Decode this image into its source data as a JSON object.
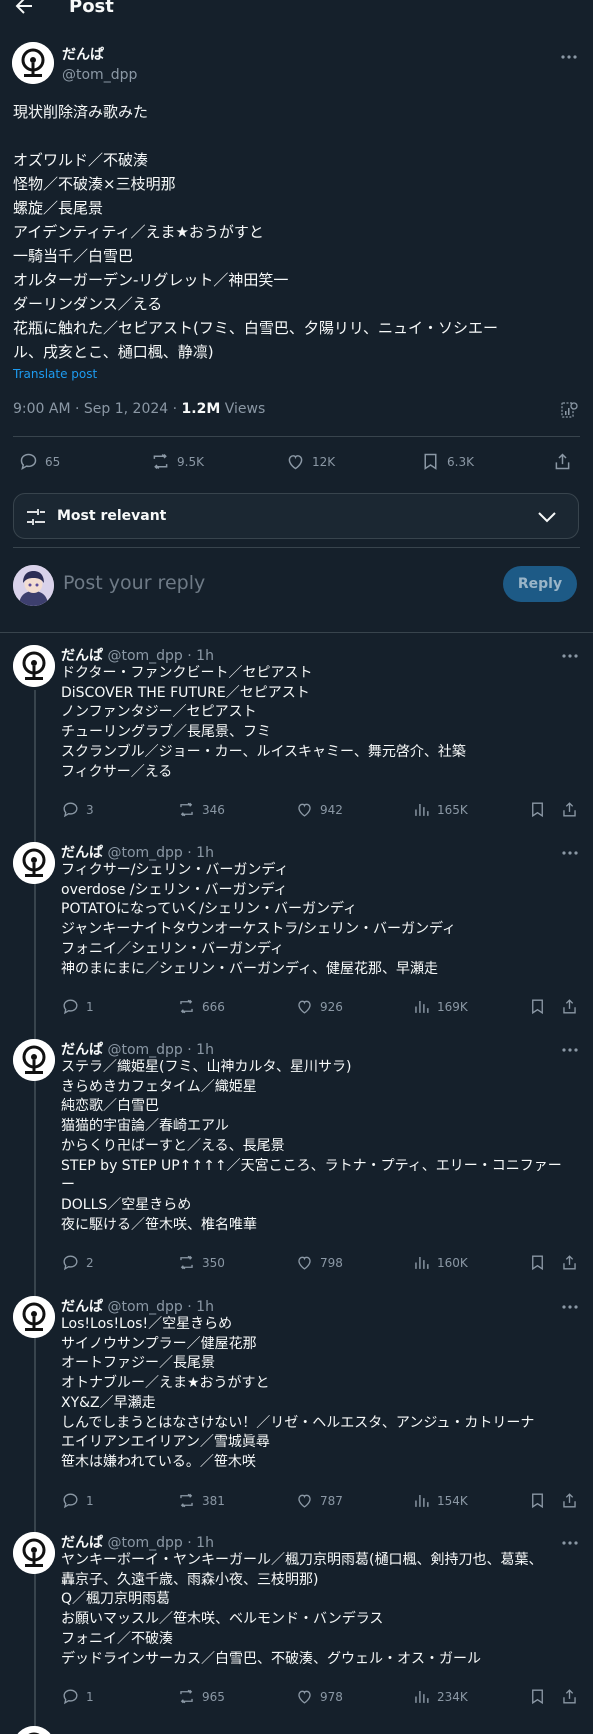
{
  "header": {
    "title": "Post"
  },
  "post": {
    "author_name": "だんぱ",
    "author_handle": "@tom_dpp",
    "text": "現状削除済み歌みた\n\nオズワルド／不破湊\n怪物／不破湊×三枝明那\n螺旋／長尾景\nアイデンティティ／えま★おうがすと\n一騎当千／白雪巴\nオルターガーデン-リグレット／神田笑一\nダーリンダンス／える\n花瓶に触れた／セピアスト(フミ、白雪巴、夕陽リリ、ニュイ・ソシエー\nル、戌亥とこ、樋口楓、静凛)",
    "translate": "Translate post",
    "time": "9:00 AM · Sep 1, 2024 · ",
    "views_count": "1.2M",
    "views_label": " Views",
    "stats": {
      "replies": "65",
      "reposts": "9.5K",
      "likes": "12K",
      "bookmarks": "6.3K"
    }
  },
  "relevance": {
    "label": "Most relevant"
  },
  "compose": {
    "placeholder": "Post your reply",
    "button": "Reply"
  },
  "replies": [
    {
      "name": "だんぱ",
      "handle": "@tom_dpp",
      "time": " · 1h",
      "text": "ドクター・ファンクビート／セピアスト\nDiSCOVER THE FUTURE／セピアスト\nノンファンタジー／セピアスト\nチューリングラブ／長尾景、フミ\nスクランブル／ジョー・カー、ルイスキャミー、舞元啓介、社築\nフィクサー／える",
      "replies": "3",
      "reposts": "346",
      "likes": "942",
      "views": "165K"
    },
    {
      "name": "だんぱ",
      "handle": "@tom_dpp",
      "time": " · 1h",
      "text": "フィクサー/シェリン・バーガンディ\noverdose /シェリン・バーガンディ\nPOTATOになっていく/シェリン・バーガンディ\nジャンキーナイトタウンオーケストラ/シェリン・バーガンディ\nフォニイ／シェリン・バーガンディ\n神のまにまに／シェリン・バーガンディ、健屋花那、早瀬走",
      "replies": "1",
      "reposts": "666",
      "likes": "926",
      "views": "169K"
    },
    {
      "name": "だんぱ",
      "handle": "@tom_dpp",
      "time": " · 1h",
      "text": "ステラ／織姫星(フミ、山神カルタ、星川サラ)\nきらめきカフェタイム／織姫星\n純恋歌／白雪巴\n猫猫的宇宙論／春崎エアル\nからくり卍ばーすと／える、長尾景\nSTEP by STEP UP↑↑↑↑／天宮こころ、ラトナ・プティ、エリー・コニファー\nー\nDOLLS／空星きらめ\n夜に駆ける／笹木咲、椎名唯華",
      "replies": "2",
      "reposts": "350",
      "likes": "798",
      "views": "160K"
    },
    {
      "name": "だんぱ",
      "handle": "@tom_dpp",
      "time": " · 1h",
      "text": "Los!Los!Los!／空星きらめ\nサイノウサンプラー／健屋花那\nオートファジー／長尾景\nオトナブルー／えま★おうがすと\nXY&Z／早瀬走\nしんでしまうとはなさけない！／リゼ・ヘルエスタ、アンジュ・カトリーナ\nエイリアンエイリアン／雪城眞尋\n笹木は嫌われている。／笹木咲",
      "replies": "1",
      "reposts": "381",
      "likes": "787",
      "views": "154K"
    },
    {
      "name": "だんぱ",
      "handle": "@tom_dpp",
      "time": " · 1h",
      "text": "ヤンキーボーイ・ヤンキーガール／楓刀京明雨葛(樋口楓、剣持刀也、葛葉、\n轟京子、久遠千歳、雨森小夜、三枝明那)\nQ／楓刀京明雨葛\nお願いマッスル／笹木咲、ベルモンド・バンデラス\nフォニイ／不破湊\nデッドラインサーカス／白雪巴、不破湊、グウェル・オス・ガール",
      "replies": "1",
      "reposts": "965",
      "likes": "978",
      "views": "234K"
    }
  ],
  "colors": {
    "background": "#15202b",
    "text": "#f7f9f9",
    "secondary": "#8b98a5",
    "accent": "#1d9bf0",
    "border": "#38444d"
  },
  "icons": [
    "back-arrow-icon",
    "more-icon",
    "analytics-icon",
    "reply-icon",
    "repost-icon",
    "like-icon",
    "bookmark-icon",
    "share-icon",
    "sort-icon",
    "chevron-down-icon",
    "views-icon"
  ]
}
